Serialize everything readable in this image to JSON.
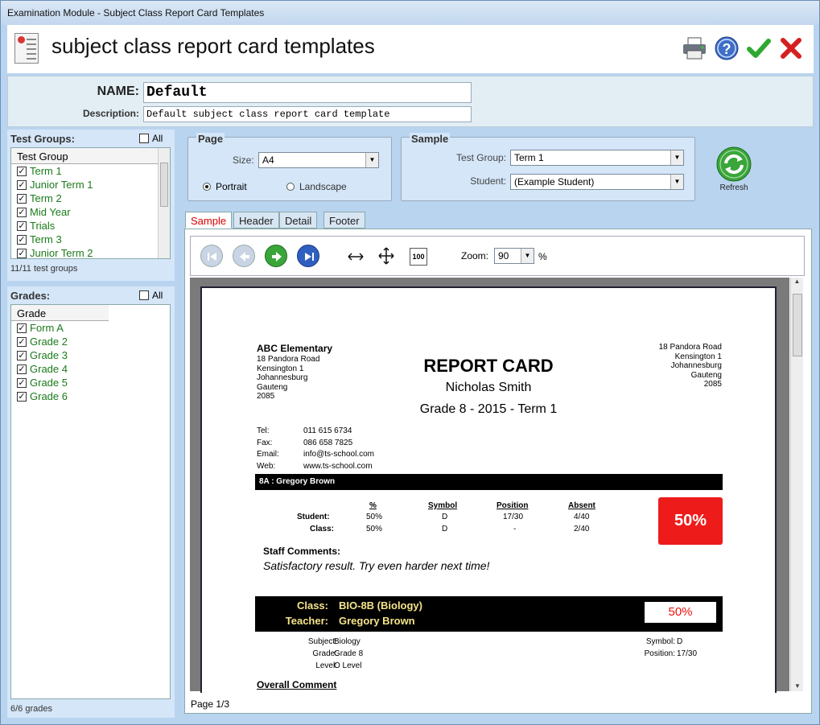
{
  "window": {
    "title": "Examination Module - Subject Class Report Card Templates"
  },
  "header": {
    "title": "subject class report card templates"
  },
  "form": {
    "name_label": "NAME:",
    "name_value": "Default",
    "desc_label": "Description:",
    "desc_value": "Default subject class report card template"
  },
  "test_groups": {
    "title": "Test Groups:",
    "all_label": "All",
    "column": "Test Group",
    "items": [
      "Term 1",
      "Junior Term 1",
      "Term 2",
      "Mid Year",
      "Trials",
      "Term 3",
      "Junior Term 2"
    ],
    "count": "11/11 test groups"
  },
  "grades": {
    "title": "Grades:",
    "all_label": "All",
    "column": "Grade",
    "items": [
      "Form A",
      "Grade 2",
      "Grade 3",
      "Grade 4",
      "Grade 5",
      "Grade 6"
    ],
    "count": "6/6 grades"
  },
  "page_group": {
    "title": "Page",
    "size_label": "Size:",
    "size_value": "A4",
    "portrait": "Portrait",
    "landscape": "Landscape"
  },
  "sample_group": {
    "title": "Sample",
    "test_group_label": "Test Group:",
    "test_group_value": "Term 1",
    "student_label": "Student:",
    "student_value": "(Example Student)"
  },
  "refresh_label": "Refresh",
  "tabs": [
    "Sample",
    "Header",
    "Detail",
    "Footer"
  ],
  "viewer": {
    "zoom_label": "Zoom:",
    "zoom_value": "90",
    "zoom_unit": "%",
    "page_status": "Page 1/3",
    "fit_label": "100"
  },
  "report": {
    "school": "ABC Elementary",
    "address_left": [
      "18 Pandora Road",
      "Kensington 1",
      "Johannesburg",
      "Gauteng",
      "2085"
    ],
    "address_right": [
      "18 Pandora Road",
      "Kensington 1",
      "Johannesburg",
      "Gauteng",
      "2085"
    ],
    "title": "REPORT CARD",
    "student": "Nicholas Smith",
    "subtitle": "Grade 8 - 2015 - Term 1",
    "contacts": [
      {
        "label": "Tel:",
        "value": "011 615 6734"
      },
      {
        "label": "Fax:",
        "value": "086 658 7825"
      },
      {
        "label": "Email:",
        "value": "info@ts-school.com"
      },
      {
        "label": "Web:",
        "value": "www.ts-school.com"
      }
    ],
    "class_bar": "8A : Gregory Brown",
    "cols": [
      "%",
      "Symbol",
      "Position",
      "Absent"
    ],
    "student_row": {
      "label": "Student:",
      "pct": "50%",
      "symbol": "D",
      "position": "17/30",
      "absent": "4/40"
    },
    "class_row": {
      "label": "Class:",
      "pct": "50%",
      "symbol": "D",
      "position": "-",
      "absent": "2/40"
    },
    "big_pct": "50%",
    "staff_comments_label": "Staff Comments:",
    "staff_comment": "Satisfactory result. Try even harder next time!",
    "class_label": "Class:",
    "class_value": "BIO-8B (Biology)",
    "teacher_label": "Teacher:",
    "teacher_value": "Gregory Brown",
    "class_pct": "50%",
    "subject_label": "Subject:",
    "subject_value": "Biology",
    "grade_label": "Grade:",
    "grade_value": "Grade 8",
    "level_label": "Level:",
    "level_value": "O Level",
    "symbol_label": "Symbol:",
    "symbol_value": "D",
    "position_label": "Position:",
    "position_value": "17/30",
    "overall_comment": "Overall Comment"
  }
}
